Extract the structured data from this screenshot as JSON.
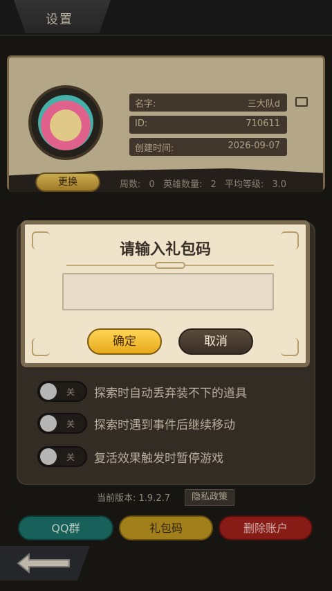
{
  "header": {
    "title": "设置"
  },
  "profile": {
    "name_label": "名字:",
    "name_value": "三大队d",
    "id_label": "ID:",
    "id_value": "710611",
    "created_label": "创建时间:",
    "created_value": "2026-09-07",
    "change_button": "更换",
    "stats": {
      "weeks": "周数: 0",
      "heroes": "英雄数量: 2",
      "avg_level": "平均等级: 3.0"
    }
  },
  "modal": {
    "title": "请输入礼包码",
    "input_value": "",
    "confirm": "确定",
    "cancel": "取消"
  },
  "settings": {
    "toggles": [
      {
        "label": "探索时自动丢弃装不下的道具",
        "state": "关"
      },
      {
        "label": "探索时遇到事件后继续移动",
        "state": "关"
      },
      {
        "label": "复活效果触发时暂停游戏",
        "state": "关"
      }
    ]
  },
  "footer": {
    "version": "当前版本: 1.9.2.7",
    "privacy": "隐私政策",
    "qq_group": "QQ群",
    "gift_code": "礼包码",
    "delete_account": "删除账户"
  },
  "colors": {
    "gold": "#e7a91c",
    "brown": "#3a2f26",
    "teal": "#1c6f67",
    "red": "#9a1f1a"
  }
}
